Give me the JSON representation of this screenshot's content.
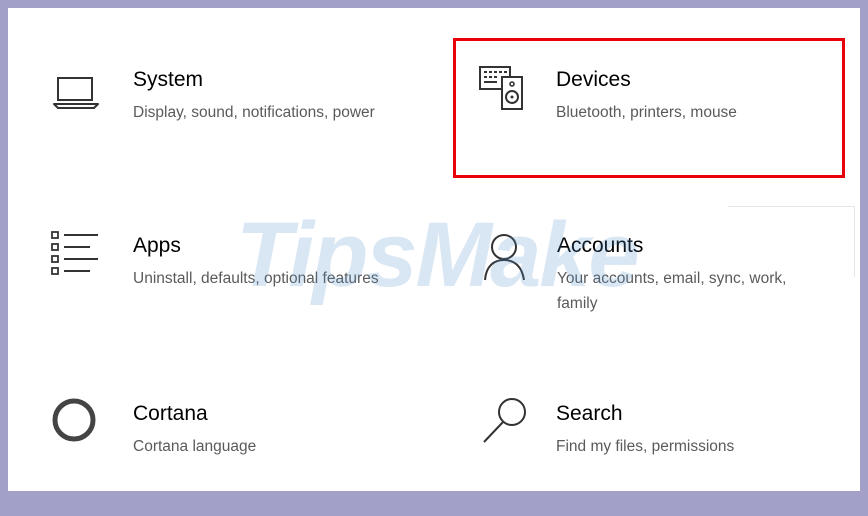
{
  "settings": {
    "tiles": [
      {
        "title": "System",
        "desc": "Display, sound, notifications, power",
        "icon": "laptop-icon"
      },
      {
        "title": "Devices",
        "desc": "Bluetooth, printers, mouse",
        "icon": "devices-icon"
      },
      {
        "title": "Apps",
        "desc": "Uninstall, defaults, optional features",
        "icon": "apps-list-icon"
      },
      {
        "title": "Accounts",
        "desc": "Your accounts, email, sync, work, family",
        "icon": "person-icon"
      },
      {
        "title": "Cortana",
        "desc": "Cortana language",
        "icon": "cortana-ring-icon"
      },
      {
        "title": "Search",
        "desc": "Find my files, permissions",
        "icon": "search-icon"
      }
    ]
  },
  "watermark": {
    "text": "TipsMake"
  },
  "colors": {
    "highlight": "#e8000b",
    "title": "#000000",
    "desc": "#5a5a5a"
  }
}
